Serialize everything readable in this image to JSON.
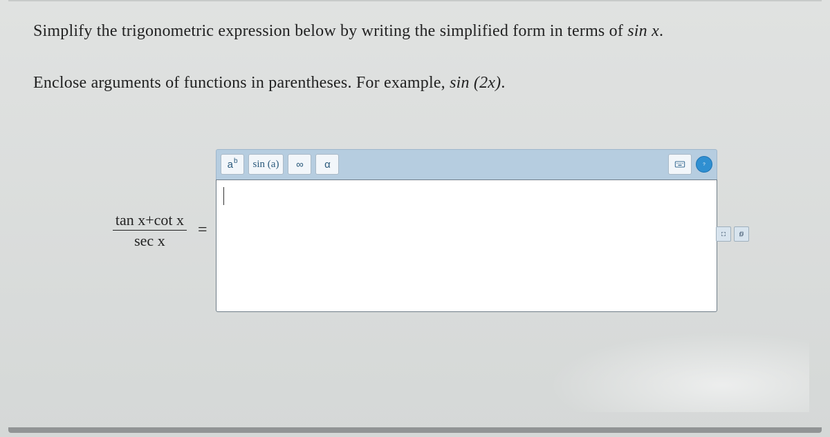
{
  "question": {
    "line1_pre": "Simplify the trigonometric expression below by writing the simplified form in terms of ",
    "line1_math": "sin x",
    "line1_post": ".",
    "line2_pre": "Enclose arguments of functions in parentheses. For example, ",
    "line2_math": "sin (2x)",
    "line2_post": "."
  },
  "lhs": {
    "numerator": "tan x+cot x",
    "denominator": "sec x"
  },
  "equals": "=",
  "toolbar": {
    "power_base": "a",
    "power_exp": "b",
    "func": "sin (a)",
    "infinity": "∞",
    "alpha": "α"
  },
  "input_value": ""
}
